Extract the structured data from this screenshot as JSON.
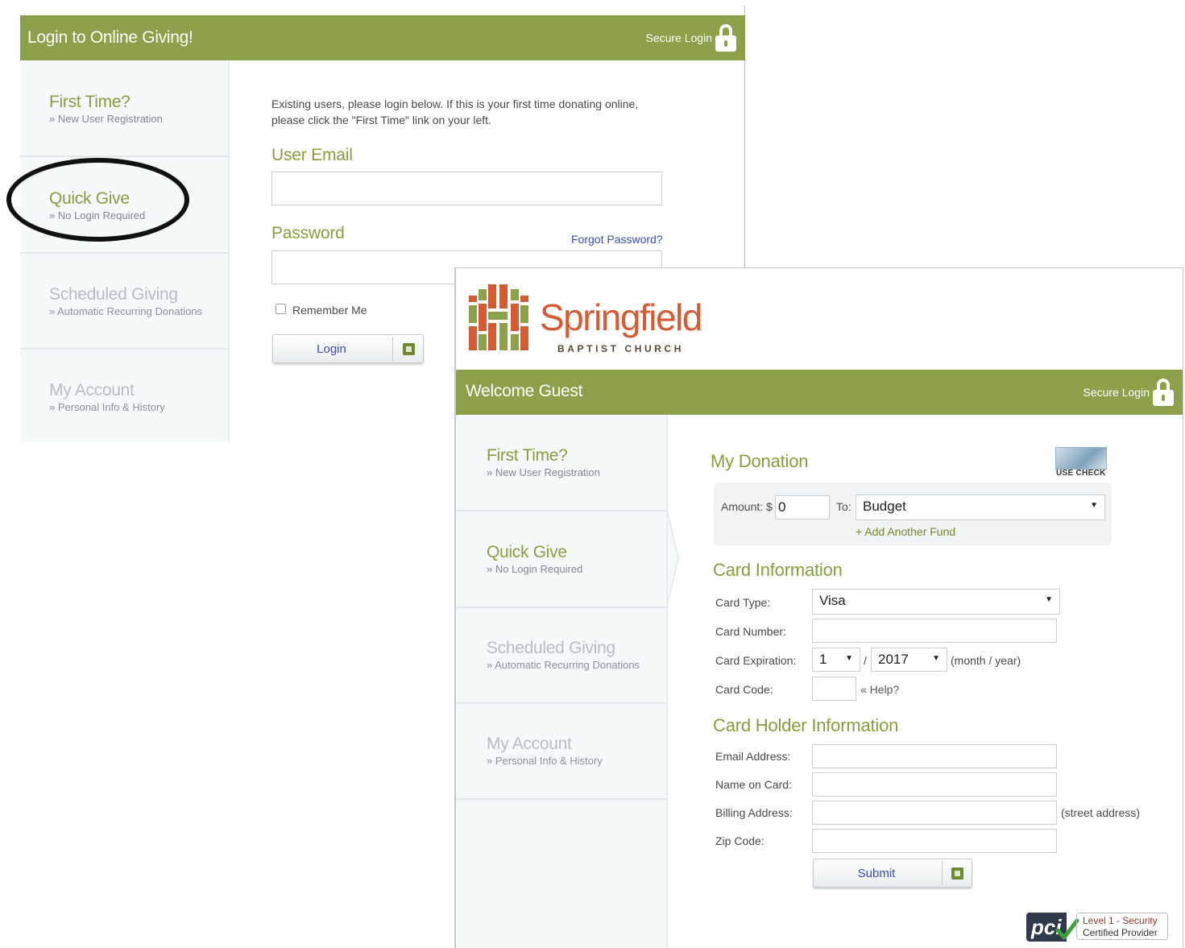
{
  "login_panel": {
    "title": "Login to Online Giving!",
    "secure_login": "Secure Login",
    "sidebar": [
      {
        "heading": "First Time?",
        "sub": "» New User Registration"
      },
      {
        "heading": "Quick Give",
        "sub": "» No Login Required"
      },
      {
        "heading": "Scheduled Giving",
        "sub": "» Automatic Recurring Donations"
      },
      {
        "heading": "My Account",
        "sub": "» Personal Info & History"
      }
    ],
    "intro_line1": "Existing users, please login below. If this is your first time donating online,",
    "intro_line2": "please click the \"First Time\" link on your left.",
    "user_email_label": "User Email",
    "user_email_value": "",
    "password_label": "Password",
    "password_value": "",
    "forgot_password": "Forgot Password?",
    "remember_me": "Remember Me",
    "login_button": "Login"
  },
  "donation_panel": {
    "logo_word": "Springfield",
    "logo_tagline": "BAPTIST CHURCH",
    "welcome": "Welcome Guest",
    "secure_login": "Secure Login",
    "sidebar": [
      {
        "heading": "First Time?",
        "sub": "» New User Registration"
      },
      {
        "heading": "Quick Give",
        "sub": "» No Login Required"
      },
      {
        "heading": "Scheduled Giving",
        "sub": "» Automatic Recurring Donations"
      },
      {
        "heading": "My Account",
        "sub": "» Personal Info & History"
      }
    ],
    "my_donation": "My Donation",
    "use_check": "USE CHECK",
    "amount_label": "Amount: $",
    "amount_value": "0",
    "to_label": "To:",
    "fund_selected": "Budget",
    "add_fund": "+ Add Another Fund",
    "card_info_title": "Card Information",
    "card_type_label": "Card Type:",
    "card_type_selected": "Visa",
    "card_number_label": "Card Number:",
    "card_number_value": "",
    "card_expiration_label": "Card Expiration:",
    "exp_month_selected": "1",
    "exp_sep": "/",
    "exp_year_selected": "2017",
    "exp_hint": "(month / year)",
    "card_code_label": "Card Code:",
    "card_code_value": "",
    "card_code_help": "« Help?",
    "holder_title": "Card Holder Information",
    "email_label": "Email Address:",
    "name_label": "Name on Card:",
    "billing_label": "Billing Address:",
    "billing_hint": "(street address)",
    "zip_label": "Zip Code:",
    "submit_button": "Submit",
    "pci_mark": "pci",
    "pci_line1": "Level 1 - Security",
    "pci_line2": "Certified Provider"
  },
  "colors": {
    "accent_green": "#8da04a",
    "heading_green": "#889e3e",
    "link_blue": "#3b4fb0",
    "logo_orange": "#d45b32",
    "annotation_circle": "#111111"
  },
  "icons": [
    "lock-icon",
    "dropdown-arrow-icon",
    "go-icon",
    "check-icon",
    "pci-badge-icon"
  ]
}
